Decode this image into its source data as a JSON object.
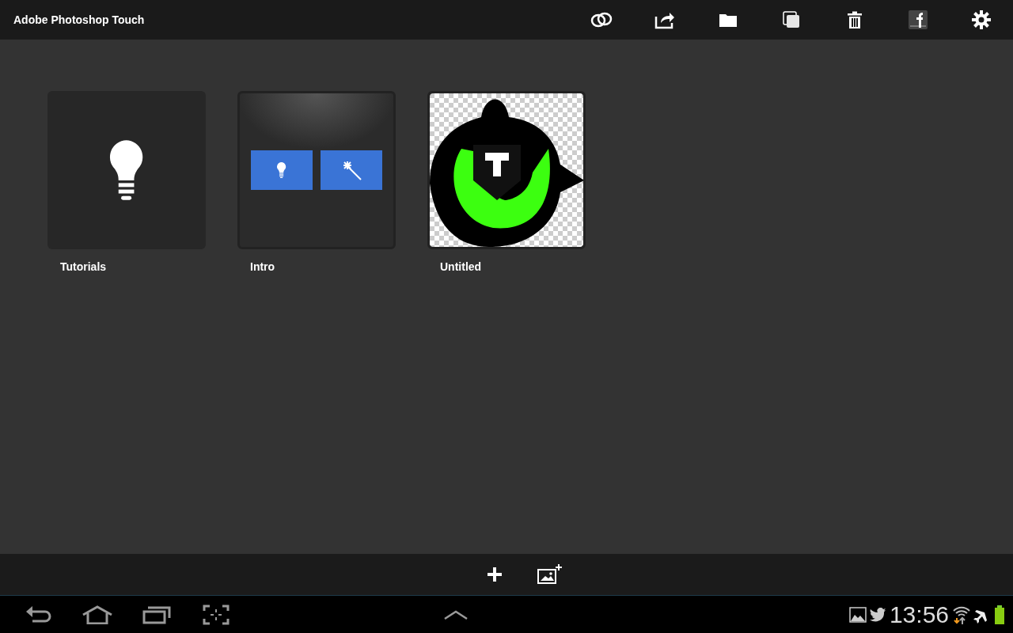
{
  "app_bar": {
    "title": "Adobe Photoshop Touch"
  },
  "projects": [
    {
      "kind": "tutorials",
      "label": "Tutorials"
    },
    {
      "kind": "intro",
      "label": "Intro"
    },
    {
      "kind": "picture",
      "label": "Untitled"
    }
  ],
  "status_bar": {
    "time": "13:56"
  }
}
